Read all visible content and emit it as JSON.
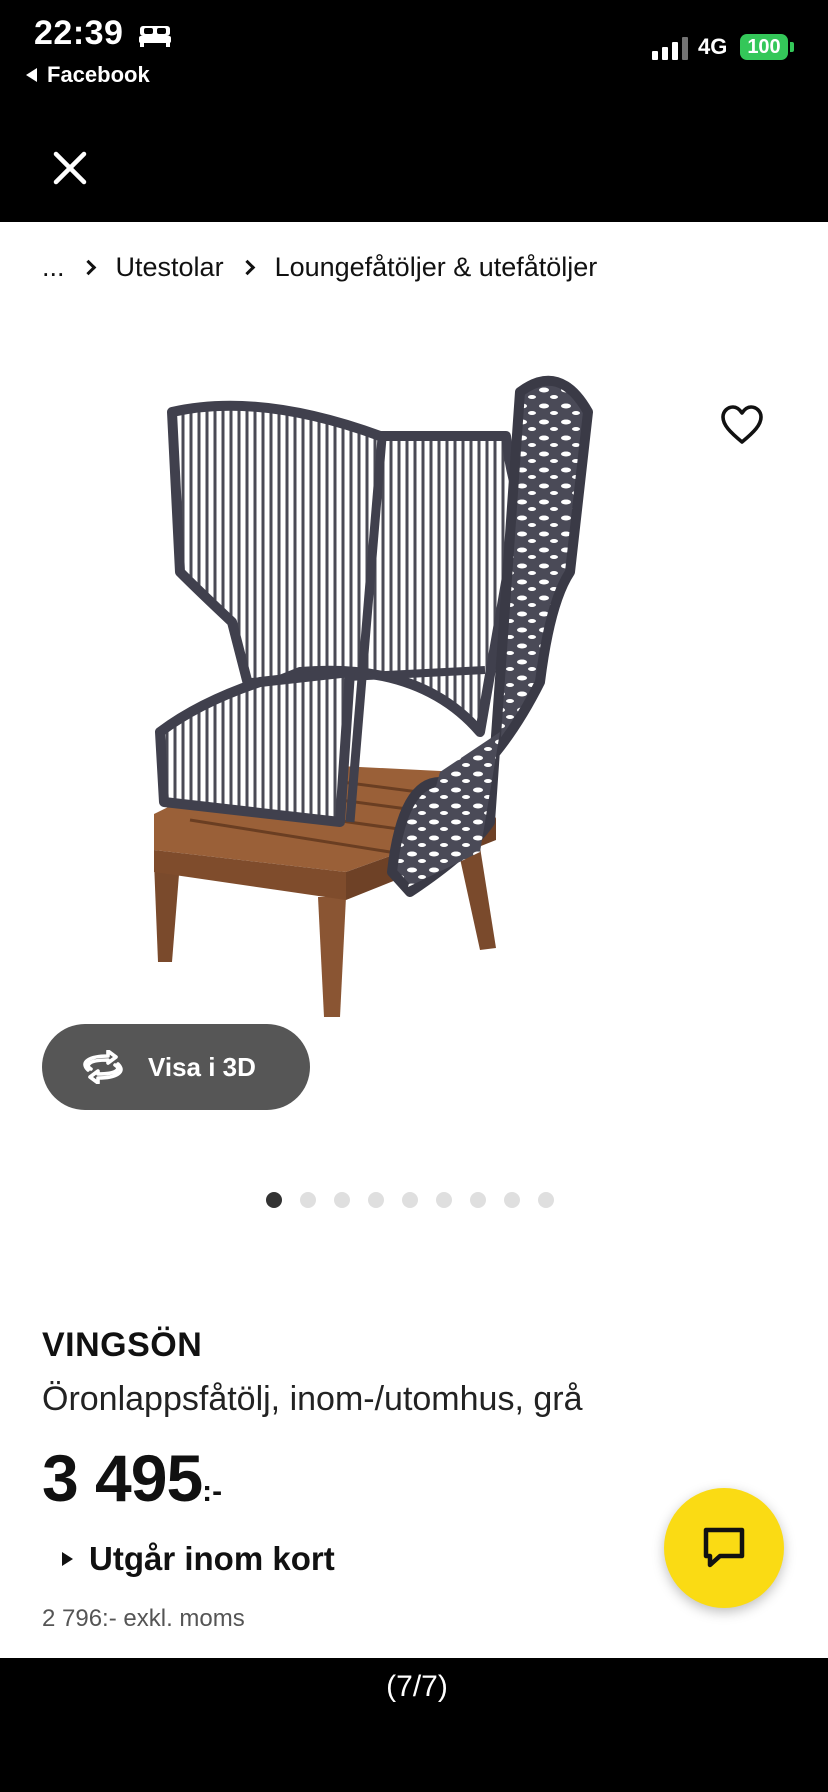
{
  "status_bar": {
    "time": "22:39",
    "back_app": "Facebook",
    "network": "4G",
    "battery": "100"
  },
  "breadcrumb": {
    "ellipsis": "...",
    "items": [
      "Utestolar",
      "Loungefåtöljer & utefåtöljer"
    ]
  },
  "gallery": {
    "view_3d_label": "Visa i 3D",
    "image_count": 9,
    "active_index": 0
  },
  "product": {
    "name": "VINGSÖN",
    "description": "Öronlappsfåtölj, inom-/utomhus, grå",
    "price": "3 495",
    "price_suffix": ":-",
    "stock_status": "Utgår inom kort",
    "price_excl_vat": "2 796:- exkl. moms"
  },
  "pager": {
    "label": "(7/7)"
  },
  "colors": {
    "chat_button": "#fadb14",
    "battery": "#34c759"
  }
}
